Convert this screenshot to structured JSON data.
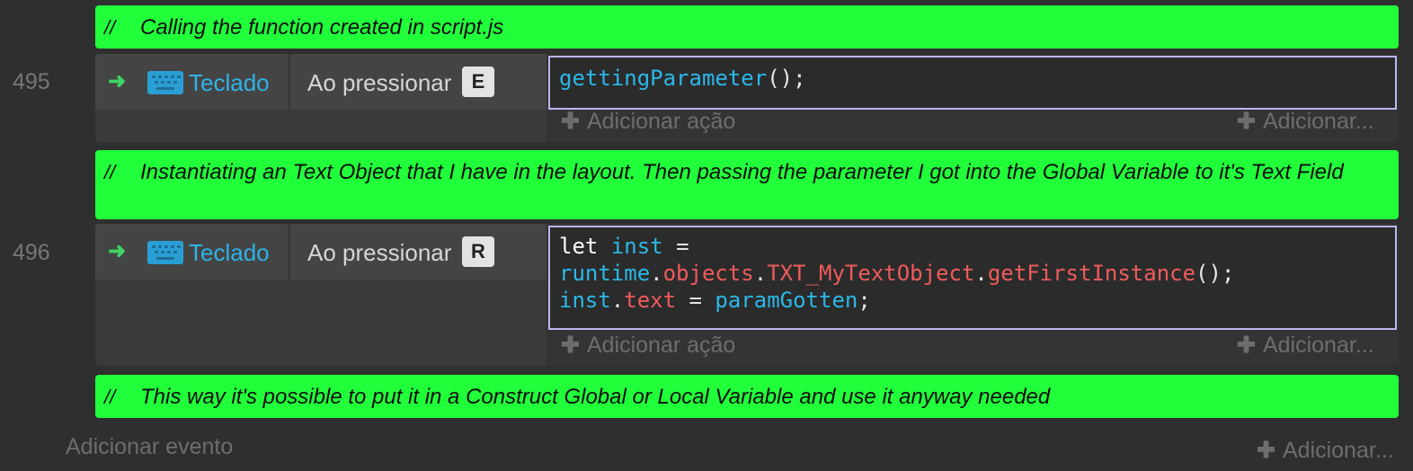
{
  "comments": [
    {
      "slashes": "//",
      "text": "Calling the function created in script.js"
    },
    {
      "slashes": "//",
      "text": "Instantiating an Text Object that I have in the layout. Then passing the parameter I got into the Global Variable to it's Text Field"
    },
    {
      "slashes": "//",
      "text": "This way it's possible to put it in a Construct Global or Local Variable and use it anyway needed"
    }
  ],
  "events": [
    {
      "number": "495",
      "object": "Teclado",
      "condition": "Ao pressionar",
      "key": "E",
      "code": "gettingParameter();",
      "add_action": "Adicionar ação",
      "add_more": "Adicionar..."
    },
    {
      "number": "496",
      "object": "Teclado",
      "condition": "Ao pressionar",
      "key": "R",
      "code": "let inst =\nruntime.objects.TXT_MyTextObject.getFirstInstance();\ninst.text = paramGotten;",
      "add_action": "Adicionar ação",
      "add_more": "Adicionar..."
    }
  ],
  "footer": {
    "add_event": "Adicionar evento",
    "add_more": "Adicionar..."
  },
  "colors": {
    "comment_bg": "#21ff3a",
    "background": "#2f2f2f",
    "identifier": "#2bb8e8",
    "member_red": "#ef5b5b",
    "arrow_green": "#3fd463"
  },
  "icons": {
    "arrow": "trigger-arrow-icon",
    "keyboard": "keyboard-icon",
    "plus": "plus-icon"
  }
}
